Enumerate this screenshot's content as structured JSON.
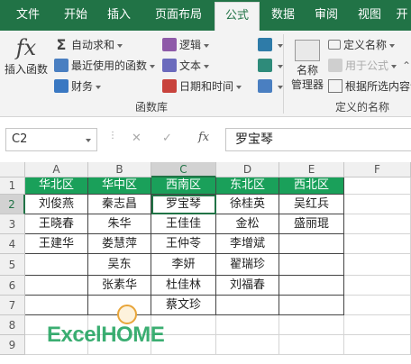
{
  "tabs": [
    {
      "label": "文件"
    },
    {
      "label": "开始"
    },
    {
      "label": "插入"
    },
    {
      "label": "页面布局"
    },
    {
      "label": "公式"
    },
    {
      "label": "数据"
    },
    {
      "label": "审阅"
    },
    {
      "label": "视图"
    },
    {
      "label": "开"
    }
  ],
  "ribbon": {
    "insert_function": "插入函数",
    "autosum": "自动求和",
    "recent": "最近使用的函数",
    "financial": "财务",
    "logical": "逻辑",
    "text": "文本",
    "datetime": "日期和时间",
    "function_library": "函数库",
    "name_manager_line1": "名称",
    "name_manager_line2": "管理器",
    "define_name": "定义名称",
    "use_in_formula": "用于公式",
    "create_from_selection": "根据所选内容创",
    "defined_names": "定义的名称",
    "fx_glyph": "fx",
    "sigma_glyph": "Σ"
  },
  "formula_bar": {
    "name_box": "C2",
    "fx_label": "fx",
    "cancel": "✕",
    "enter": "✓",
    "value": "罗宝琴"
  },
  "sheet": {
    "columns": [
      "A",
      "B",
      "C",
      "D",
      "E",
      "F"
    ],
    "rows": [
      "1",
      "2",
      "3",
      "4",
      "5",
      "6",
      "7",
      "8",
      "9"
    ],
    "headers": [
      "华北区",
      "华中区",
      "西南区",
      "东北区",
      "西北区"
    ],
    "data": [
      [
        "刘俊燕",
        "秦志昌",
        "罗宝琴",
        "徐桂英",
        "吴红兵"
      ],
      [
        "王晓春",
        "朱华",
        "王佳佳",
        "金松",
        "盛丽琨"
      ],
      [
        "王建华",
        "娄慧萍",
        "王仲苓",
        "李增斌",
        ""
      ],
      [
        "",
        "吴东",
        "李妍",
        "翟瑞珍",
        ""
      ],
      [
        "",
        "张素华",
        "杜佳林",
        "刘福春",
        ""
      ],
      [
        "",
        "",
        "蔡文珍",
        "",
        ""
      ]
    ]
  },
  "watermark": {
    "brand": "ExcelHOME"
  },
  "colors": {
    "excel_green": "#217346",
    "header_fill": "#1aa05a"
  }
}
